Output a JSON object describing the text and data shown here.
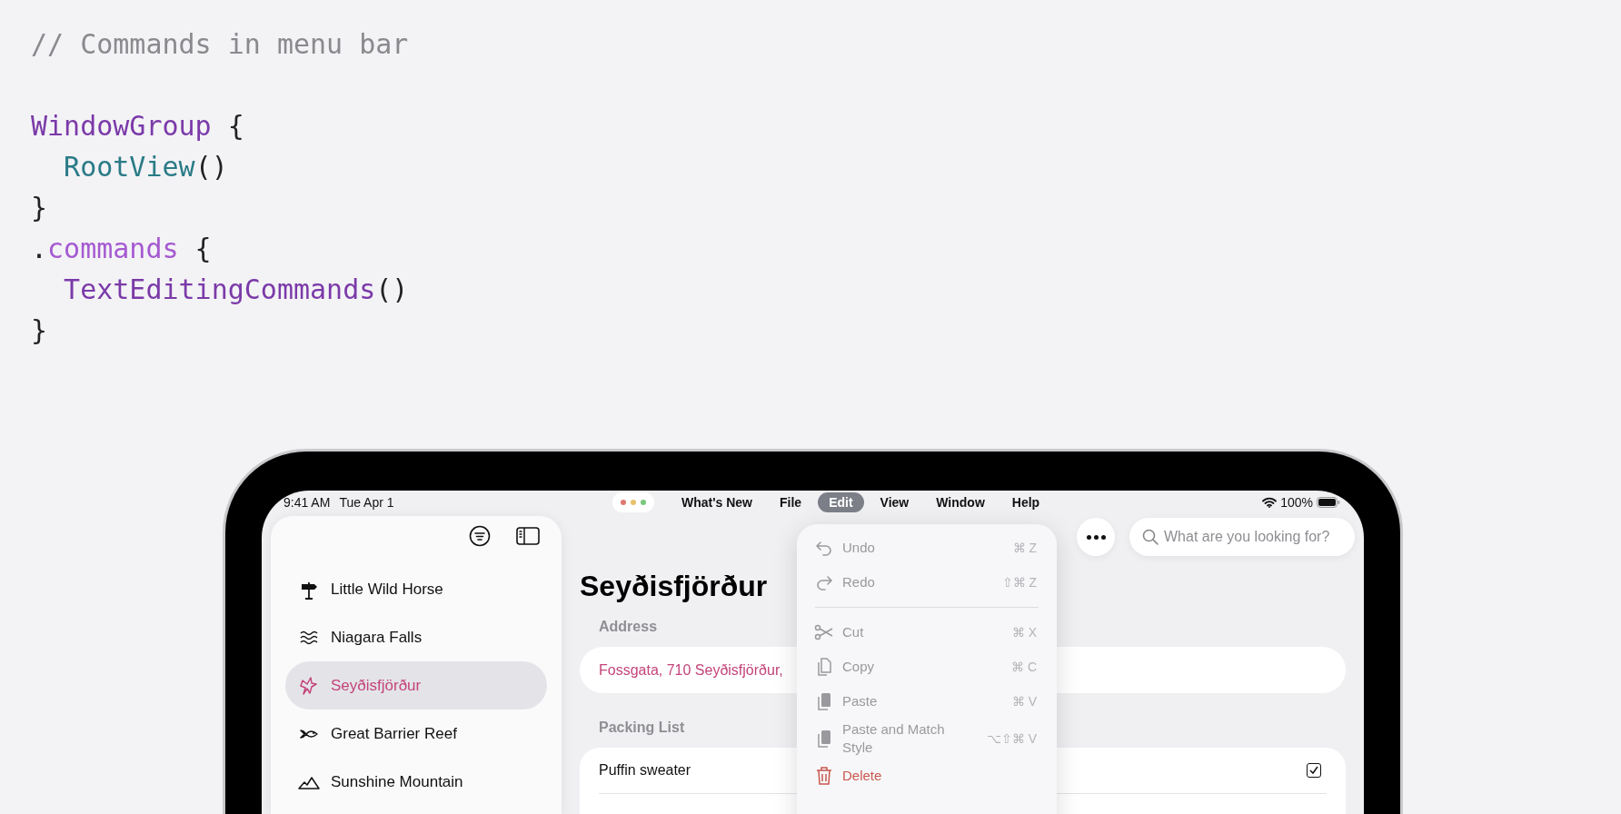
{
  "code_comment": "// Commands in menu bar",
  "code": [
    {
      "tokens": [
        {
          "text": "WindowGroup",
          "kind": "type"
        },
        {
          "text": " {",
          "kind": "plain"
        }
      ]
    },
    {
      "tokens": [
        {
          "text": "  RootView",
          "kind": "call"
        },
        {
          "text": "()",
          "kind": "plain"
        }
      ]
    },
    {
      "tokens": [
        {
          "text": "}",
          "kind": "plain"
        }
      ]
    },
    {
      "tokens": [
        {
          "text": ".",
          "kind": "plain"
        },
        {
          "text": "commands",
          "kind": "method"
        },
        {
          "text": " {",
          "kind": "plain"
        }
      ]
    },
    {
      "tokens": [
        {
          "text": "  TextEditingCommands",
          "kind": "type"
        },
        {
          "text": "()",
          "kind": "plain"
        }
      ]
    },
    {
      "tokens": [
        {
          "text": "}",
          "kind": "plain"
        }
      ]
    }
  ],
  "status_bar": {
    "time": "9:41 AM",
    "date": "Tue Apr 1",
    "battery": "100%"
  },
  "menu_bar": [
    {
      "label": "What's New",
      "selected": false
    },
    {
      "label": "File",
      "selected": false
    },
    {
      "label": "Edit",
      "selected": true
    },
    {
      "label": "View",
      "selected": false
    },
    {
      "label": "Window",
      "selected": false
    },
    {
      "label": "Help",
      "selected": false
    }
  ],
  "sidebar": {
    "items": [
      {
        "label": "Little Wild Horse",
        "selected": false
      },
      {
        "label": "Niagara Falls",
        "selected": false
      },
      {
        "label": "Seyðisfjörður",
        "selected": true
      },
      {
        "label": "Great Barrier Reef",
        "selected": false
      },
      {
        "label": "Sunshine Mountain",
        "selected": false
      }
    ]
  },
  "detail": {
    "title": "Seyðisfjörður",
    "address_label": "Address",
    "address": "Fossgata, 710 Seyðisfjörður,",
    "packing_label": "Packing List",
    "packing_items": [
      {
        "label": "Puffin sweater",
        "checked": true
      }
    ]
  },
  "search": {
    "placeholder": "What are you looking for?"
  },
  "edit_menu": [
    {
      "label": "Undo",
      "shortcut": "⌘ Z",
      "kind": "normal",
      "disabled": true
    },
    {
      "label": "Redo",
      "shortcut": "⇧⌘ Z",
      "kind": "normal",
      "disabled": true
    },
    {
      "kind": "separator"
    },
    {
      "label": "Cut",
      "shortcut": "⌘ X",
      "kind": "normal",
      "disabled": true
    },
    {
      "label": "Copy",
      "shortcut": "⌘ C",
      "kind": "normal",
      "disabled": true
    },
    {
      "label": "Paste",
      "shortcut": "⌘ V",
      "kind": "normal",
      "disabled": true
    },
    {
      "label": "Paste and Match Style",
      "shortcut": "⌥⇧⌘ V",
      "kind": "normal",
      "disabled": true
    },
    {
      "label": "Delete",
      "kind": "destructive",
      "disabled": true
    }
  ]
}
